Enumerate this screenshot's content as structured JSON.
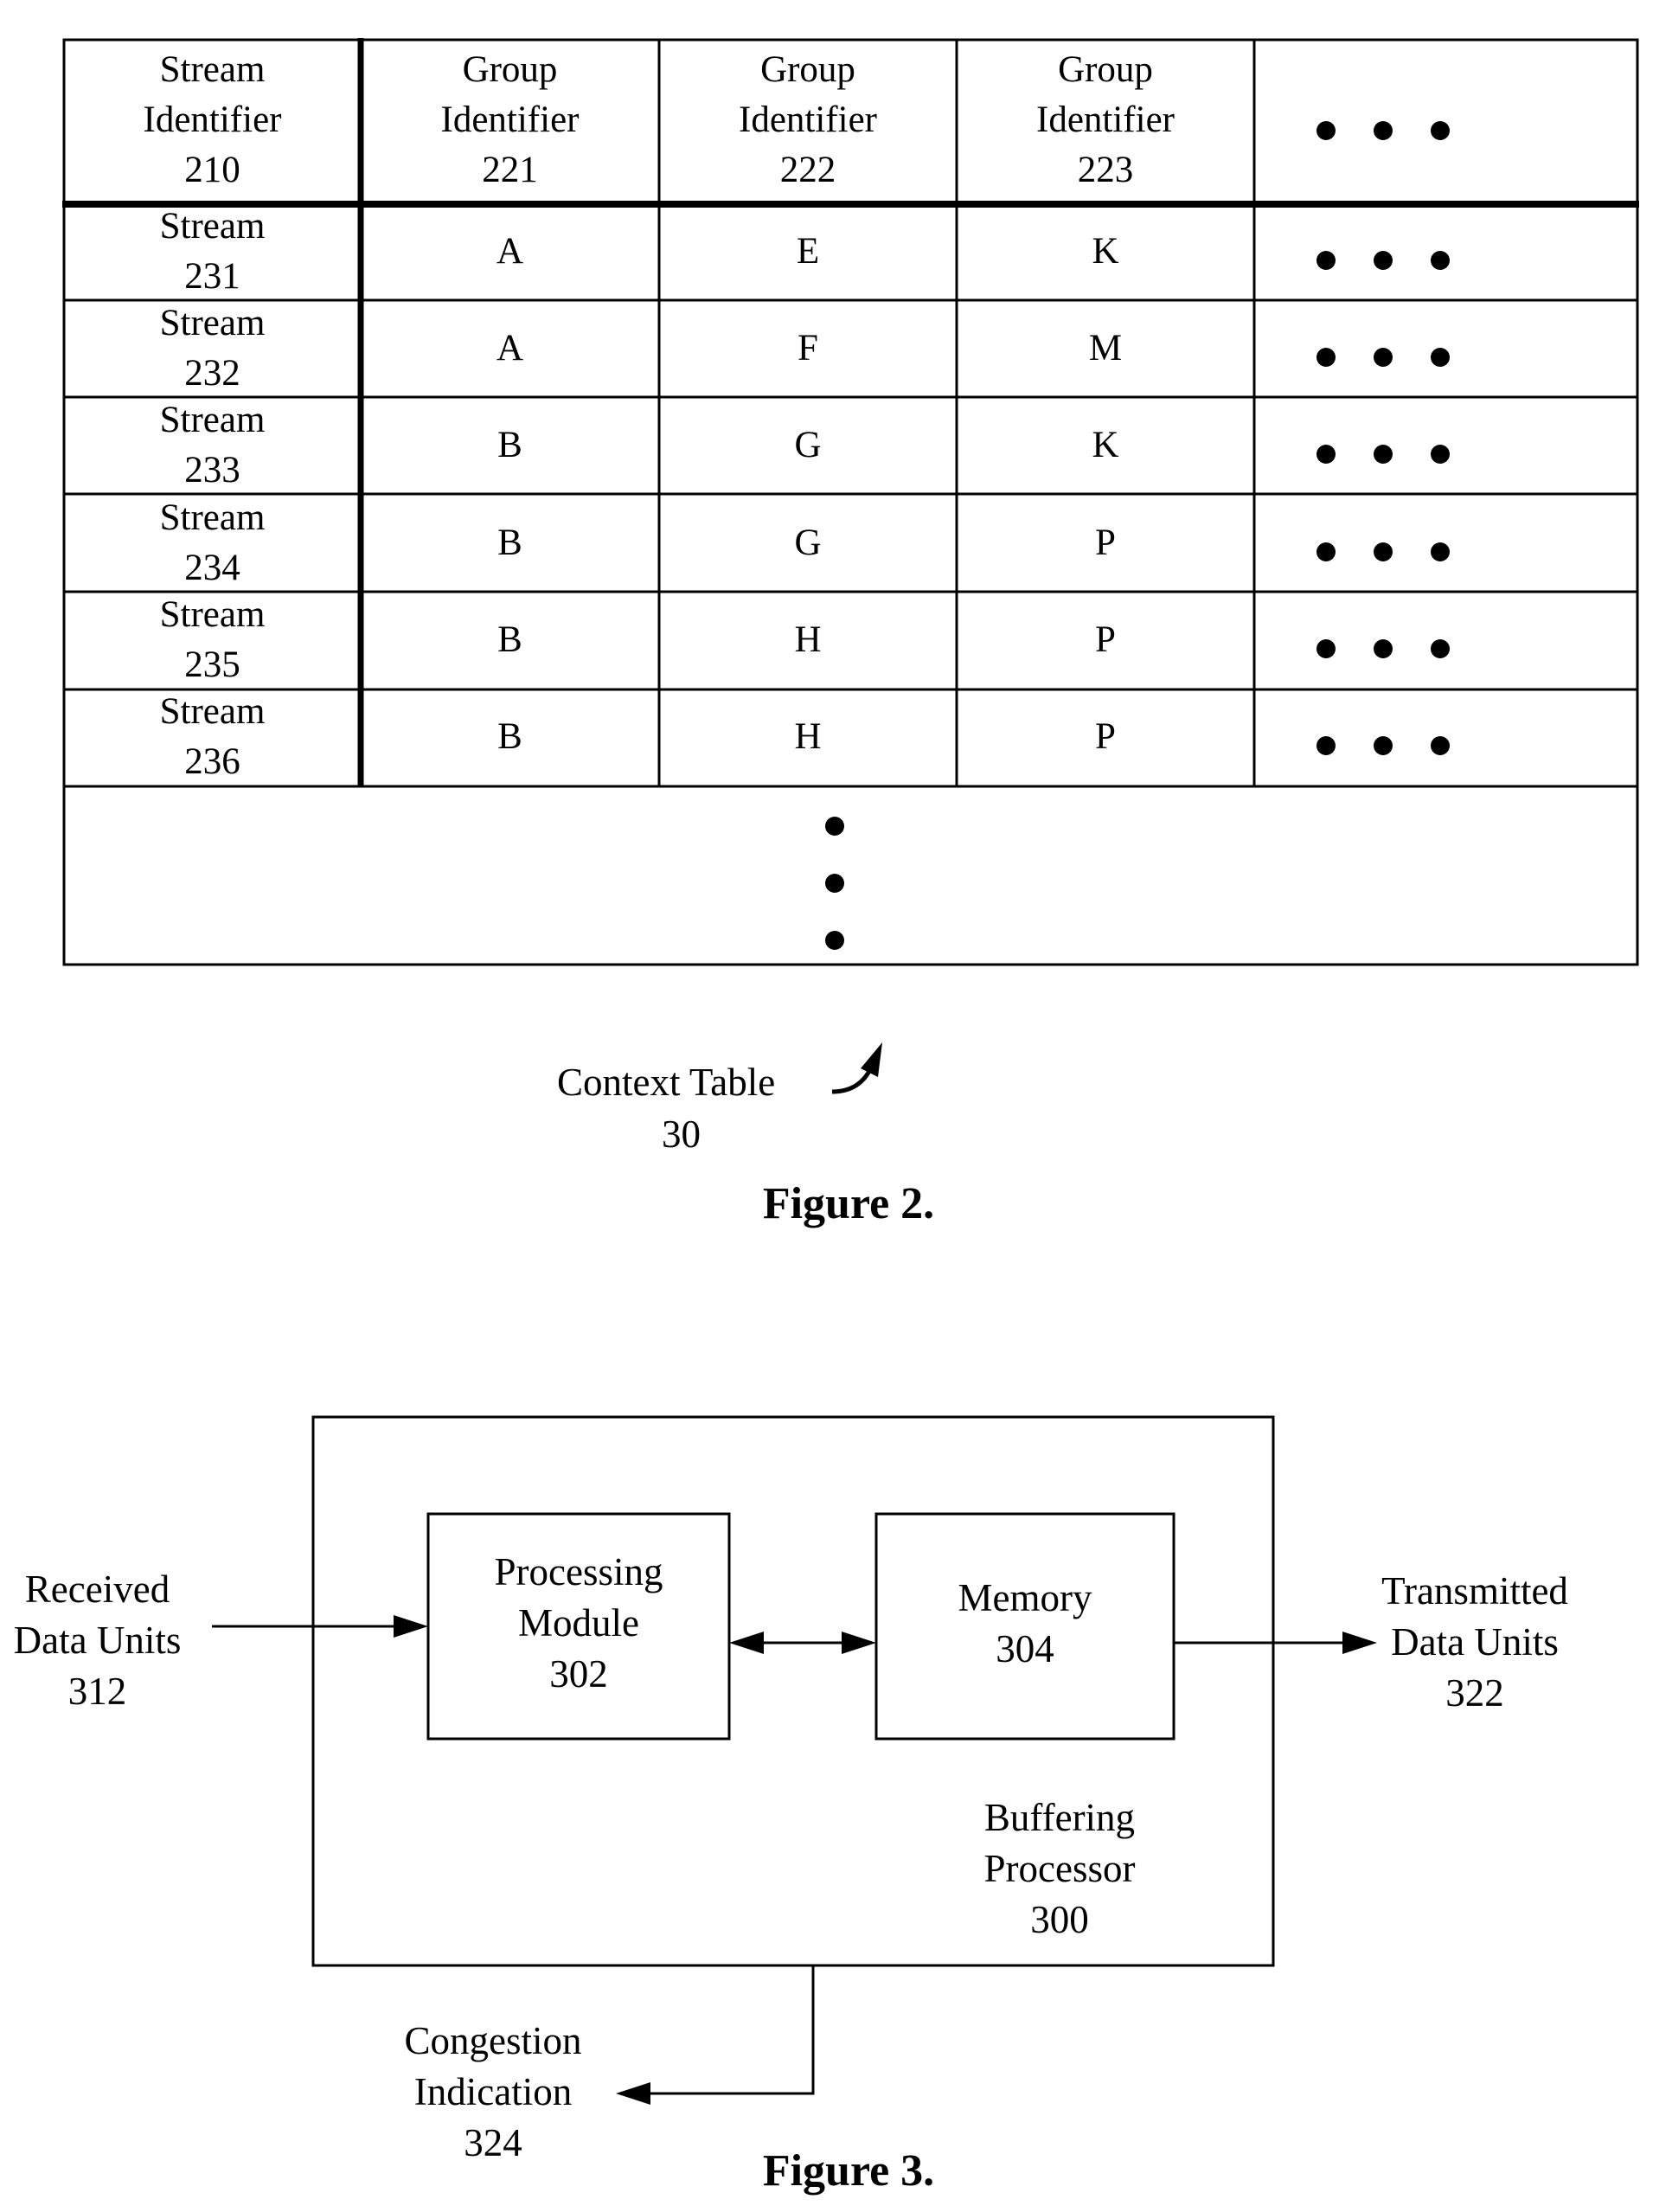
{
  "figure2": {
    "caption": "Figure 2.",
    "table_label": "Context Table",
    "table_ref": "30",
    "headers": [
      {
        "line1": "Stream",
        "line2": "Identifier",
        "ref": "210"
      },
      {
        "line1": "Group",
        "line2": "Identifier",
        "ref": "221"
      },
      {
        "line1": "Group",
        "line2": "Identifier",
        "ref": "222"
      },
      {
        "line1": "Group",
        "line2": "Identifier",
        "ref": "223"
      }
    ],
    "rows": [
      {
        "stream": "Stream",
        "ref": "231",
        "g221": "A",
        "g222": "E",
        "g223": "K"
      },
      {
        "stream": "Stream",
        "ref": "232",
        "g221": "A",
        "g222": "F",
        "g223": "M"
      },
      {
        "stream": "Stream",
        "ref": "233",
        "g221": "B",
        "g222": "G",
        "g223": "K"
      },
      {
        "stream": "Stream",
        "ref": "234",
        "g221": "B",
        "g222": "G",
        "g223": "P"
      },
      {
        "stream": "Stream",
        "ref": "235",
        "g221": "B",
        "g222": "H",
        "g223": "P"
      },
      {
        "stream": "Stream",
        "ref": "236",
        "g221": "B",
        "g222": "H",
        "g223": "P"
      }
    ]
  },
  "figure3": {
    "caption": "Figure 3.",
    "processing": {
      "line1": "Processing",
      "line2": "Module",
      "ref": "302"
    },
    "memory": {
      "line1": "Memory",
      "ref": "304"
    },
    "buffering": {
      "line1": "Buffering",
      "line2": "Processor",
      "ref": "300"
    },
    "received": {
      "line1": "Received",
      "line2": "Data Units",
      "ref": "312"
    },
    "transmitted": {
      "line1": "Transmitted",
      "line2": "Data Units",
      "ref": "322"
    },
    "congestion": {
      "line1": "Congestion",
      "line2": "Indication",
      "ref": "324"
    }
  }
}
